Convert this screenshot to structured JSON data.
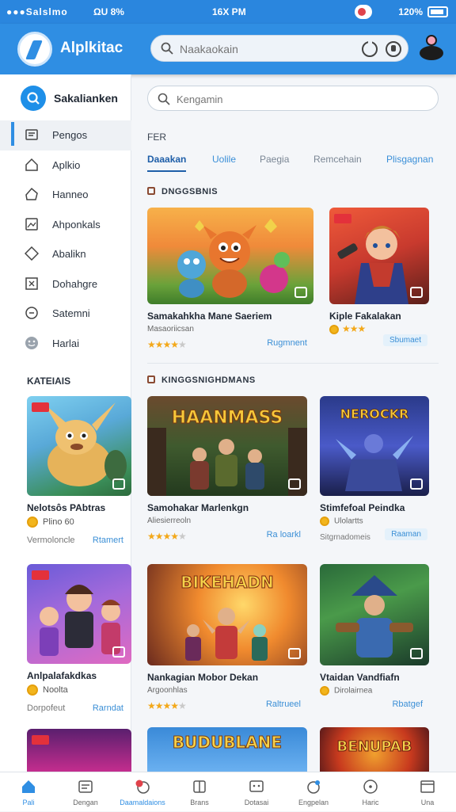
{
  "status_bar": {
    "left": "●●●Salslmo",
    "network": "ΩU 8%",
    "time": "16X PM",
    "right": "120%"
  },
  "app": {
    "name": "Alplkitac",
    "search_placeholder": "Naakaokain"
  },
  "sidebar": {
    "header_label": "Sakalianken",
    "items": [
      {
        "label": "Pengos",
        "icon": "image-icon"
      },
      {
        "label": "Aplkio",
        "icon": "home-icon"
      },
      {
        "label": "Hanneo",
        "icon": "house-alt-icon"
      },
      {
        "label": "Ahponkals",
        "icon": "photo-icon"
      },
      {
        "label": "Abalikn",
        "icon": "tag-icon"
      },
      {
        "label": "Dohahgre",
        "icon": "grid-icon"
      },
      {
        "label": "Satemni",
        "icon": "chat-icon"
      },
      {
        "label": "Harlai",
        "icon": "smile-icon"
      }
    ],
    "section_title": "KATEIAIS",
    "cards": [
      {
        "title": "Nelotsôs PAbtras",
        "meta": "Plino 60",
        "footer": "Vermoloncle",
        "link": "Rtamert"
      },
      {
        "title": "Anlpalafakdkas",
        "meta": "Noolta",
        "footer": "Dorpofeut",
        "link": "Rarndat"
      }
    ]
  },
  "main": {
    "search_placeholder": "Kengamin",
    "section_label": "FER",
    "tabs": [
      "Daaakan",
      "Uolile",
      "Paegia",
      "Remcehain",
      "Plisgagnan"
    ],
    "section1_title": "DNGGSBNIS",
    "section2_title": "KINGGSNIGHDMANS",
    "row1": [
      {
        "title": "Samakahkha Mane Saeriem",
        "sub": "Masaoriicsan",
        "rating": 4.5,
        "link": "Rugmnent"
      },
      {
        "title": "Kiple Fakalakan",
        "sub": "",
        "rating": 3,
        "link": "Sbumaet"
      }
    ],
    "row2": [
      {
        "title": "Samohakar Marlenkgn",
        "sub": "Aliesierreoln",
        "rating": 4.5,
        "link": "Ra loarkl",
        "banner": "HAANMASS"
      },
      {
        "title": "Stimfefoal Peindka",
        "sub": "Ulolartts",
        "footer": "Sitgrnadomeis",
        "link": "Raaman",
        "banner": "NEROCKR"
      }
    ],
    "row3": [
      {
        "title": "Nankagian Mobor Dekan",
        "sub": "Argoonhlas",
        "rating": 4,
        "link": "Raltrueel",
        "banner": "BIKEHADN"
      },
      {
        "title": "Vtaidan Vandfiafn",
        "sub": "Dirolairnea",
        "link": "Rbatgef"
      }
    ],
    "row4": [
      {
        "banner": "BUDUBLANE"
      },
      {
        "banner": "BENUPAB"
      }
    ]
  },
  "bottom_nav": [
    {
      "label": "Pali",
      "icon": "home-icon"
    },
    {
      "label": "Dengan",
      "icon": "card-icon"
    },
    {
      "label": "Daamaldaions",
      "icon": "notification-icon"
    },
    {
      "label": "Brans",
      "icon": "bookmark-icon"
    },
    {
      "label": "Dotasai",
      "icon": "chat-box-icon"
    },
    {
      "label": "Engpelan",
      "icon": "bell-icon"
    },
    {
      "label": "Haric",
      "icon": "compass-icon"
    },
    {
      "label": "Una",
      "icon": "window-icon"
    }
  ],
  "colors": {
    "primary": "#2f8ee3",
    "accent_blue": "#1e5ea8",
    "star": "#f3a81a"
  }
}
